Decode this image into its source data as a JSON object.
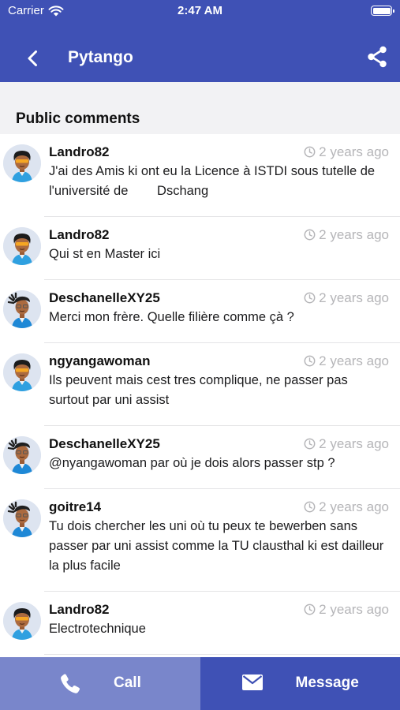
{
  "status_bar": {
    "carrier": "Carrier",
    "time": "2:47 AM"
  },
  "nav": {
    "title": "Pytango",
    "back_icon": "chevron-left-icon",
    "share_icon": "share-icon"
  },
  "section": {
    "title": "Public comments"
  },
  "comments": [
    {
      "author": "Landro82",
      "time": "2 years ago",
      "text": "J'ai des Amis ki ont eu la Licence à ISTDI sous tutelle de l'université de        Dschang",
      "avatar": "afro"
    },
    {
      "author": "Landro82",
      "time": "2 years ago",
      "text": "Qui st en Master ici",
      "avatar": "afro"
    },
    {
      "author": "DeschanelleXY25",
      "time": "2 years ago",
      "text": "Merci mon frère. Quelle filière comme çà ?",
      "avatar": "dreads"
    },
    {
      "author": "ngyangawoman",
      "time": "2 years ago",
      "text": "Ils peuvent mais cest tres complique, ne passer pas surtout par uni assist",
      "avatar": "afro"
    },
    {
      "author": "DeschanelleXY25",
      "time": "2 years ago",
      "text": "@nyangawoman par où je dois alors passer stp ?",
      "avatar": "dreads"
    },
    {
      "author": "goitre14",
      "time": "2 years ago",
      "text": "Tu dois chercher les uni où tu peux te bewerben sans passer par uni assist comme la TU clausthal ki est dailleur la plus facile",
      "avatar": "dreads"
    },
    {
      "author": "Landro82",
      "time": "2 years ago",
      "text": "Electrotechnique",
      "avatar": "afro"
    }
  ],
  "footer": {
    "call_label": "Call",
    "message_label": "Message",
    "call_color": "#7986cb",
    "message_color": "#3f51b5"
  },
  "colors": {
    "primary": "#3f51b5",
    "secondary": "#7986cb",
    "muted": "#b5b5b8"
  }
}
